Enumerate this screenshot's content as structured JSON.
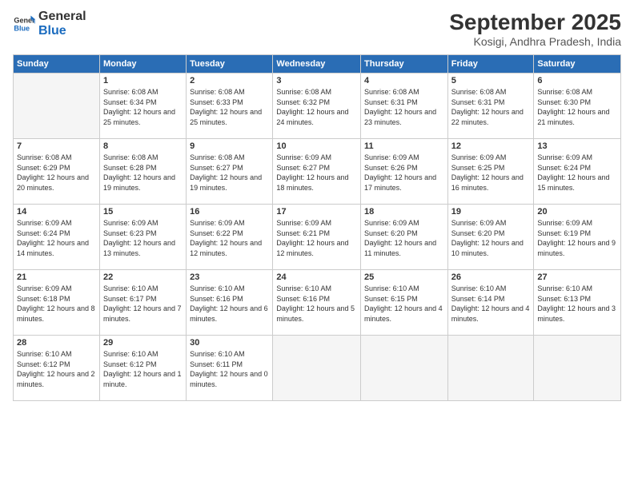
{
  "header": {
    "logo_line1": "General",
    "logo_line2": "Blue",
    "month": "September 2025",
    "location": "Kosigi, Andhra Pradesh, India"
  },
  "weekdays": [
    "Sunday",
    "Monday",
    "Tuesday",
    "Wednesday",
    "Thursday",
    "Friday",
    "Saturday"
  ],
  "weeks": [
    [
      {
        "day": "",
        "empty": true
      },
      {
        "day": "1",
        "sunrise": "6:08 AM",
        "sunset": "6:34 PM",
        "daylight": "12 hours and 25 minutes."
      },
      {
        "day": "2",
        "sunrise": "6:08 AM",
        "sunset": "6:33 PM",
        "daylight": "12 hours and 25 minutes."
      },
      {
        "day": "3",
        "sunrise": "6:08 AM",
        "sunset": "6:32 PM",
        "daylight": "12 hours and 24 minutes."
      },
      {
        "day": "4",
        "sunrise": "6:08 AM",
        "sunset": "6:31 PM",
        "daylight": "12 hours and 23 minutes."
      },
      {
        "day": "5",
        "sunrise": "6:08 AM",
        "sunset": "6:31 PM",
        "daylight": "12 hours and 22 minutes."
      },
      {
        "day": "6",
        "sunrise": "6:08 AM",
        "sunset": "6:30 PM",
        "daylight": "12 hours and 21 minutes."
      }
    ],
    [
      {
        "day": "7",
        "sunrise": "6:08 AM",
        "sunset": "6:29 PM",
        "daylight": "12 hours and 20 minutes."
      },
      {
        "day": "8",
        "sunrise": "6:08 AM",
        "sunset": "6:28 PM",
        "daylight": "12 hours and 19 minutes."
      },
      {
        "day": "9",
        "sunrise": "6:08 AM",
        "sunset": "6:27 PM",
        "daylight": "12 hours and 19 minutes."
      },
      {
        "day": "10",
        "sunrise": "6:09 AM",
        "sunset": "6:27 PM",
        "daylight": "12 hours and 18 minutes."
      },
      {
        "day": "11",
        "sunrise": "6:09 AM",
        "sunset": "6:26 PM",
        "daylight": "12 hours and 17 minutes."
      },
      {
        "day": "12",
        "sunrise": "6:09 AM",
        "sunset": "6:25 PM",
        "daylight": "12 hours and 16 minutes."
      },
      {
        "day": "13",
        "sunrise": "6:09 AM",
        "sunset": "6:24 PM",
        "daylight": "12 hours and 15 minutes."
      }
    ],
    [
      {
        "day": "14",
        "sunrise": "6:09 AM",
        "sunset": "6:24 PM",
        "daylight": "12 hours and 14 minutes."
      },
      {
        "day": "15",
        "sunrise": "6:09 AM",
        "sunset": "6:23 PM",
        "daylight": "12 hours and 13 minutes."
      },
      {
        "day": "16",
        "sunrise": "6:09 AM",
        "sunset": "6:22 PM",
        "daylight": "12 hours and 12 minutes."
      },
      {
        "day": "17",
        "sunrise": "6:09 AM",
        "sunset": "6:21 PM",
        "daylight": "12 hours and 12 minutes."
      },
      {
        "day": "18",
        "sunrise": "6:09 AM",
        "sunset": "6:20 PM",
        "daylight": "12 hours and 11 minutes."
      },
      {
        "day": "19",
        "sunrise": "6:09 AM",
        "sunset": "6:20 PM",
        "daylight": "12 hours and 10 minutes."
      },
      {
        "day": "20",
        "sunrise": "6:09 AM",
        "sunset": "6:19 PM",
        "daylight": "12 hours and 9 minutes."
      }
    ],
    [
      {
        "day": "21",
        "sunrise": "6:09 AM",
        "sunset": "6:18 PM",
        "daylight": "12 hours and 8 minutes."
      },
      {
        "day": "22",
        "sunrise": "6:10 AM",
        "sunset": "6:17 PM",
        "daylight": "12 hours and 7 minutes."
      },
      {
        "day": "23",
        "sunrise": "6:10 AM",
        "sunset": "6:16 PM",
        "daylight": "12 hours and 6 minutes."
      },
      {
        "day": "24",
        "sunrise": "6:10 AM",
        "sunset": "6:16 PM",
        "daylight": "12 hours and 5 minutes."
      },
      {
        "day": "25",
        "sunrise": "6:10 AM",
        "sunset": "6:15 PM",
        "daylight": "12 hours and 4 minutes."
      },
      {
        "day": "26",
        "sunrise": "6:10 AM",
        "sunset": "6:14 PM",
        "daylight": "12 hours and 4 minutes."
      },
      {
        "day": "27",
        "sunrise": "6:10 AM",
        "sunset": "6:13 PM",
        "daylight": "12 hours and 3 minutes."
      }
    ],
    [
      {
        "day": "28",
        "sunrise": "6:10 AM",
        "sunset": "6:12 PM",
        "daylight": "12 hours and 2 minutes."
      },
      {
        "day": "29",
        "sunrise": "6:10 AM",
        "sunset": "6:12 PM",
        "daylight": "12 hours and 1 minute."
      },
      {
        "day": "30",
        "sunrise": "6:10 AM",
        "sunset": "6:11 PM",
        "daylight": "12 hours and 0 minutes."
      },
      {
        "day": "",
        "empty": true
      },
      {
        "day": "",
        "empty": true
      },
      {
        "day": "",
        "empty": true
      },
      {
        "day": "",
        "empty": true
      }
    ]
  ]
}
